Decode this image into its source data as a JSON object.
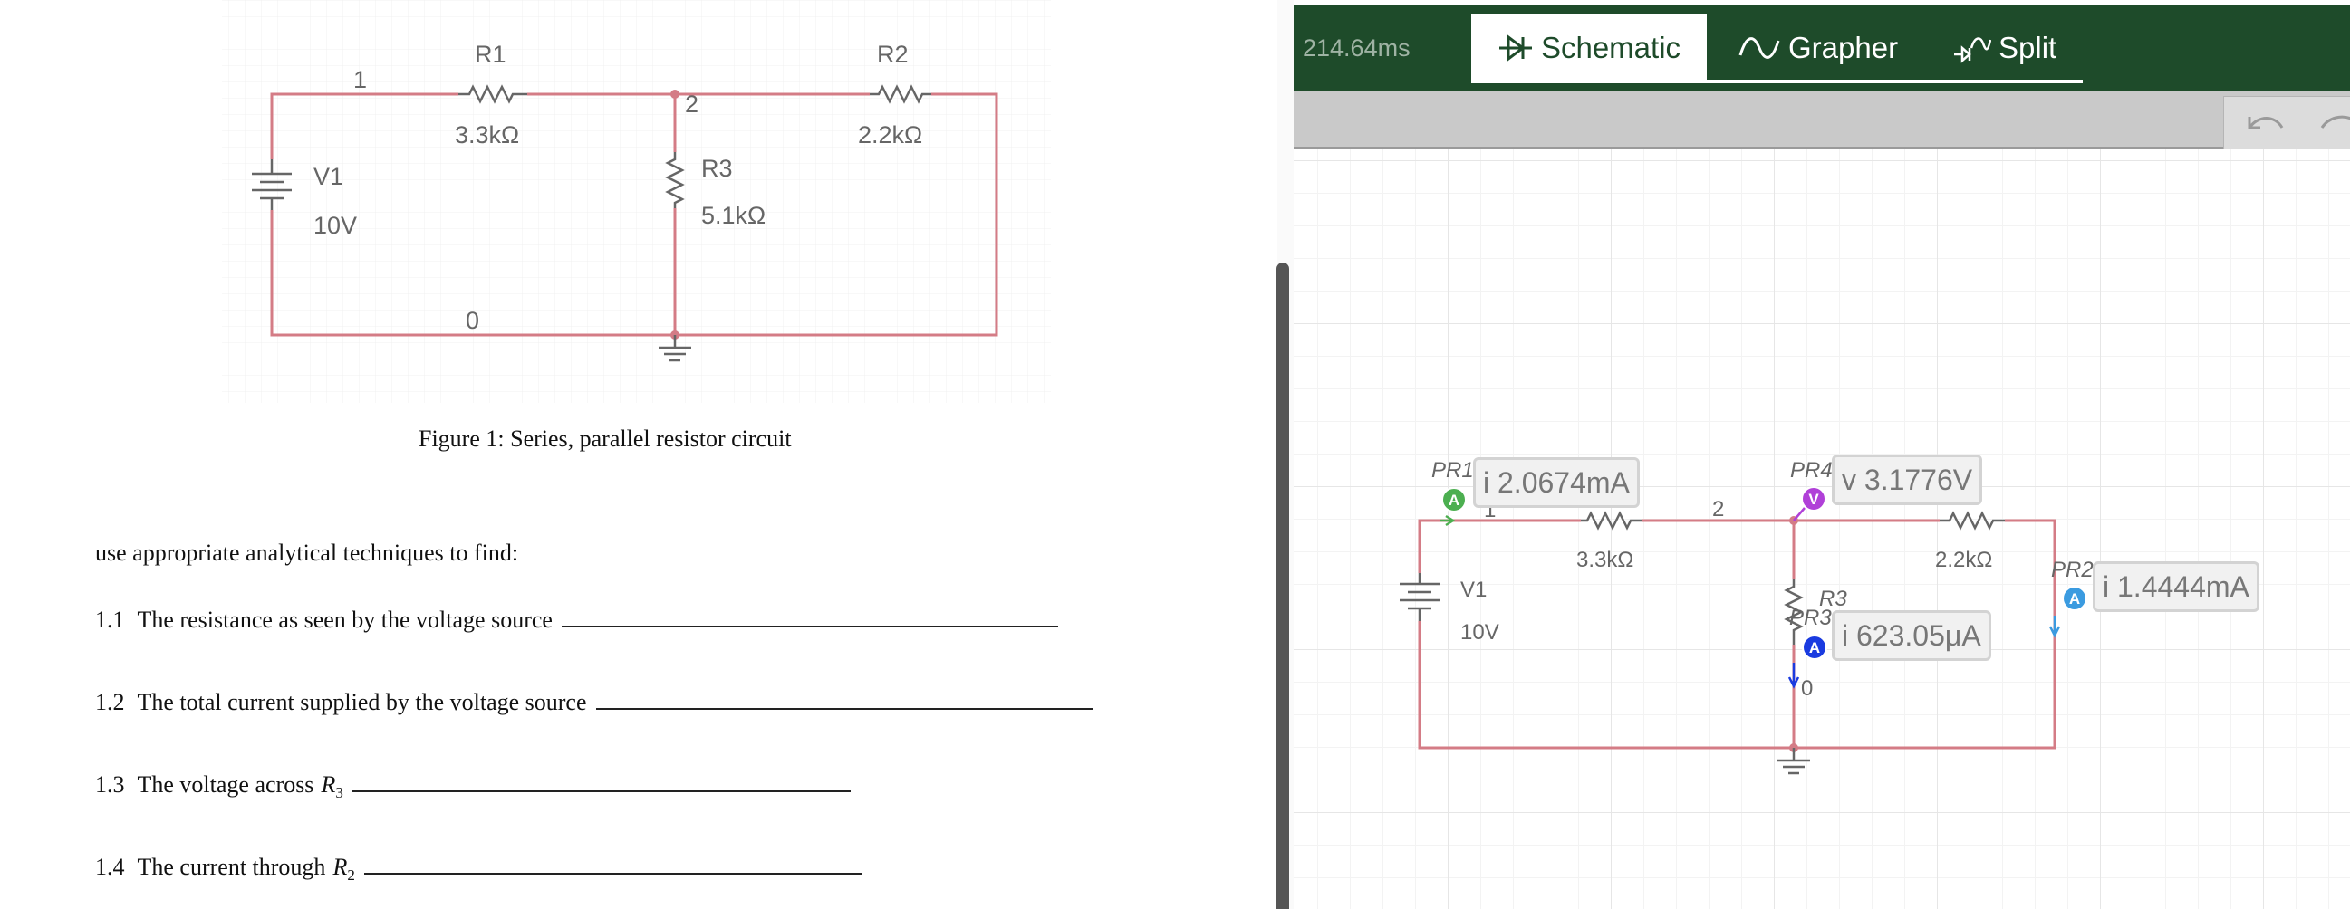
{
  "document": {
    "figure": {
      "node_labels": [
        "1",
        "2",
        "0"
      ],
      "components": {
        "r1": {
          "name": "R1",
          "value": "3.3kΩ"
        },
        "r2": {
          "name": "R2",
          "value": "2.2kΩ"
        },
        "r3": {
          "name": "R3",
          "value": "5.1kΩ"
        },
        "v1": {
          "name": "V1",
          "value": "10V"
        }
      }
    },
    "caption": "Figure 1: Series, parallel resistor circuit",
    "intro": "use appropriate analytical techniques to find:",
    "questions": [
      {
        "num": "1.1",
        "text": "The resistance as seen by the voltage source",
        "var": "",
        "sub": ""
      },
      {
        "num": "1.2",
        "text": "The total current supplied by the voltage source",
        "var": "",
        "sub": ""
      },
      {
        "num": "1.3",
        "text": "The voltage across",
        "var": "R",
        "sub": "3"
      },
      {
        "num": "1.4",
        "text": "The current through",
        "var": "R",
        "sub": "2"
      }
    ]
  },
  "app": {
    "elapsed": "214.64ms",
    "tabs": [
      {
        "label": "Schematic",
        "active": true
      },
      {
        "label": "Grapher",
        "active": false
      },
      {
        "label": "Split",
        "active": false
      }
    ],
    "schematic": {
      "nodes": [
        "1",
        "2",
        "0"
      ],
      "v1": {
        "name": "V1",
        "value": "10V"
      },
      "r1_value": "3.3kΩ",
      "r2_value": "2.2kΩ",
      "r3": {
        "name": "R3",
        "alias": "PR3"
      },
      "probes": {
        "pr1": {
          "name": "PR1",
          "reading": "i 2.0674mA",
          "badge": "A",
          "color": "#4caf50"
        },
        "pr4": {
          "name": "PR4",
          "reading": "v 3.1776V",
          "badge": "V",
          "color": "#b040d8"
        },
        "pr3": {
          "reading": "i 623.05μA",
          "badge": "A",
          "color": "#1a3be0"
        },
        "pr2": {
          "name": "PR2",
          "reading": "i 1.4444mA",
          "badge": "A",
          "color": "#3b9be0"
        }
      }
    }
  }
}
